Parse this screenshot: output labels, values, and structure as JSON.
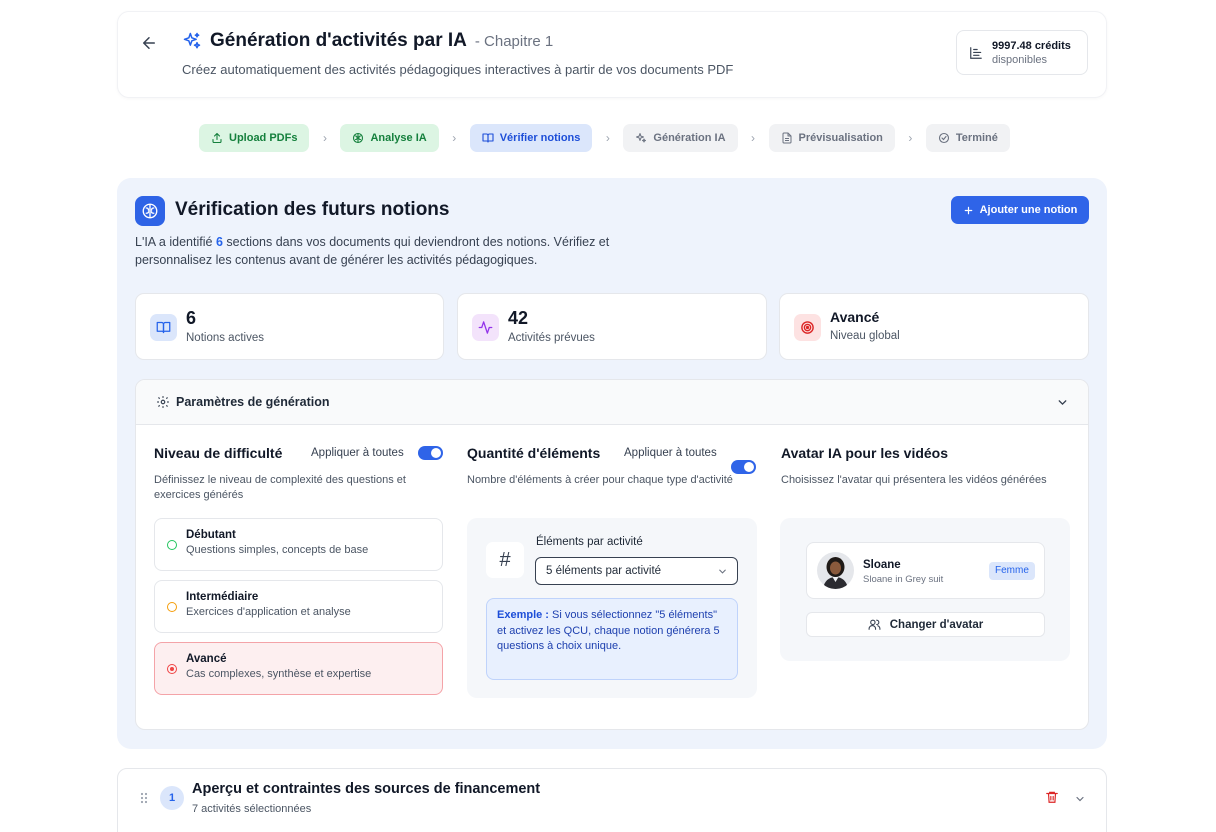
{
  "header": {
    "title": "Génération d'activités par IA",
    "subtitle": "- Chapitre 1",
    "description": "Créez automatiquement des activités pédagogiques interactives à partir de vos documents PDF",
    "credits_amount": "9997.48 crédits",
    "credits_label": "disponibles"
  },
  "stepper": {
    "steps": [
      {
        "label": "Upload PDFs",
        "status": "done",
        "icon": "upload-icon"
      },
      {
        "label": "Analyse IA",
        "status": "done",
        "icon": "brain-icon"
      },
      {
        "label": "Vérifier notions",
        "status": "active",
        "icon": "book-icon"
      },
      {
        "label": "Génération IA",
        "status": "todo",
        "icon": "sparkles-icon"
      },
      {
        "label": "Prévisualisation",
        "status": "todo",
        "icon": "file-icon"
      },
      {
        "label": "Terminé",
        "status": "todo",
        "icon": "check-circle-icon"
      }
    ]
  },
  "section": {
    "title": "Vérification des futurs notions",
    "add_button": "Ajouter une notion",
    "intro_pre": "L'IA a identifié",
    "intro_count": "6",
    "intro_post": "sections dans vos documents qui deviendront des notions. Vérifiez et personnalisez les contenus avant de générer les activités pédagogiques."
  },
  "stats": [
    {
      "value": "6",
      "label": "Notions actives",
      "icon": "book-open-icon",
      "color": "#2563eb"
    },
    {
      "value": "42",
      "label": "Activités prévues",
      "icon": "activity-icon",
      "color": "#9333ea"
    },
    {
      "value": "Avancé",
      "label": "Niveau global",
      "icon": "target-icon",
      "color": "#dc2626"
    }
  ],
  "params": {
    "title": "Paramètres de génération",
    "difficulty": {
      "title": "Niveau de difficulté",
      "apply_all": "Appliquer à toutes",
      "description": "Définissez le niveau de complexité des questions et exercices générés",
      "options": [
        {
          "name": "Débutant",
          "desc": "Questions simples, concepts de base",
          "color": "#22c55e",
          "selected": false
        },
        {
          "name": "Intermédiaire",
          "desc": "Exercices d'application et analyse",
          "color": "#f59e0b",
          "selected": false
        },
        {
          "name": "Avancé",
          "desc": "Cas complexes, synthèse et expertise",
          "color": "#ef4444",
          "selected": true
        }
      ]
    },
    "quantity": {
      "title": "Quantité d'éléments",
      "apply_all": "Appliquer à toutes",
      "description": "Nombre d'éléments à créer pour chaque type d'activité",
      "field_label": "Éléments par activité",
      "selected_value": "5 éléments par activité",
      "example_label": "Exemple :",
      "example_text": "Si vous sélectionnez \"5 éléments\" et activez les QCU, chaque notion générera 5 questions à choix unique."
    },
    "avatar": {
      "title": "Avatar IA pour les vidéos",
      "description": "Choisissez l'avatar qui présentera les vidéos générées",
      "name": "Sloane",
      "subtitle": "Sloane in Grey suit",
      "badge": "Femme",
      "change_button": "Changer d'avatar"
    }
  },
  "notions": [
    {
      "number": "1",
      "title": "Aperçu et contraintes des sources de financement",
      "subtitle": "7 activités sélectionnées"
    }
  ]
}
